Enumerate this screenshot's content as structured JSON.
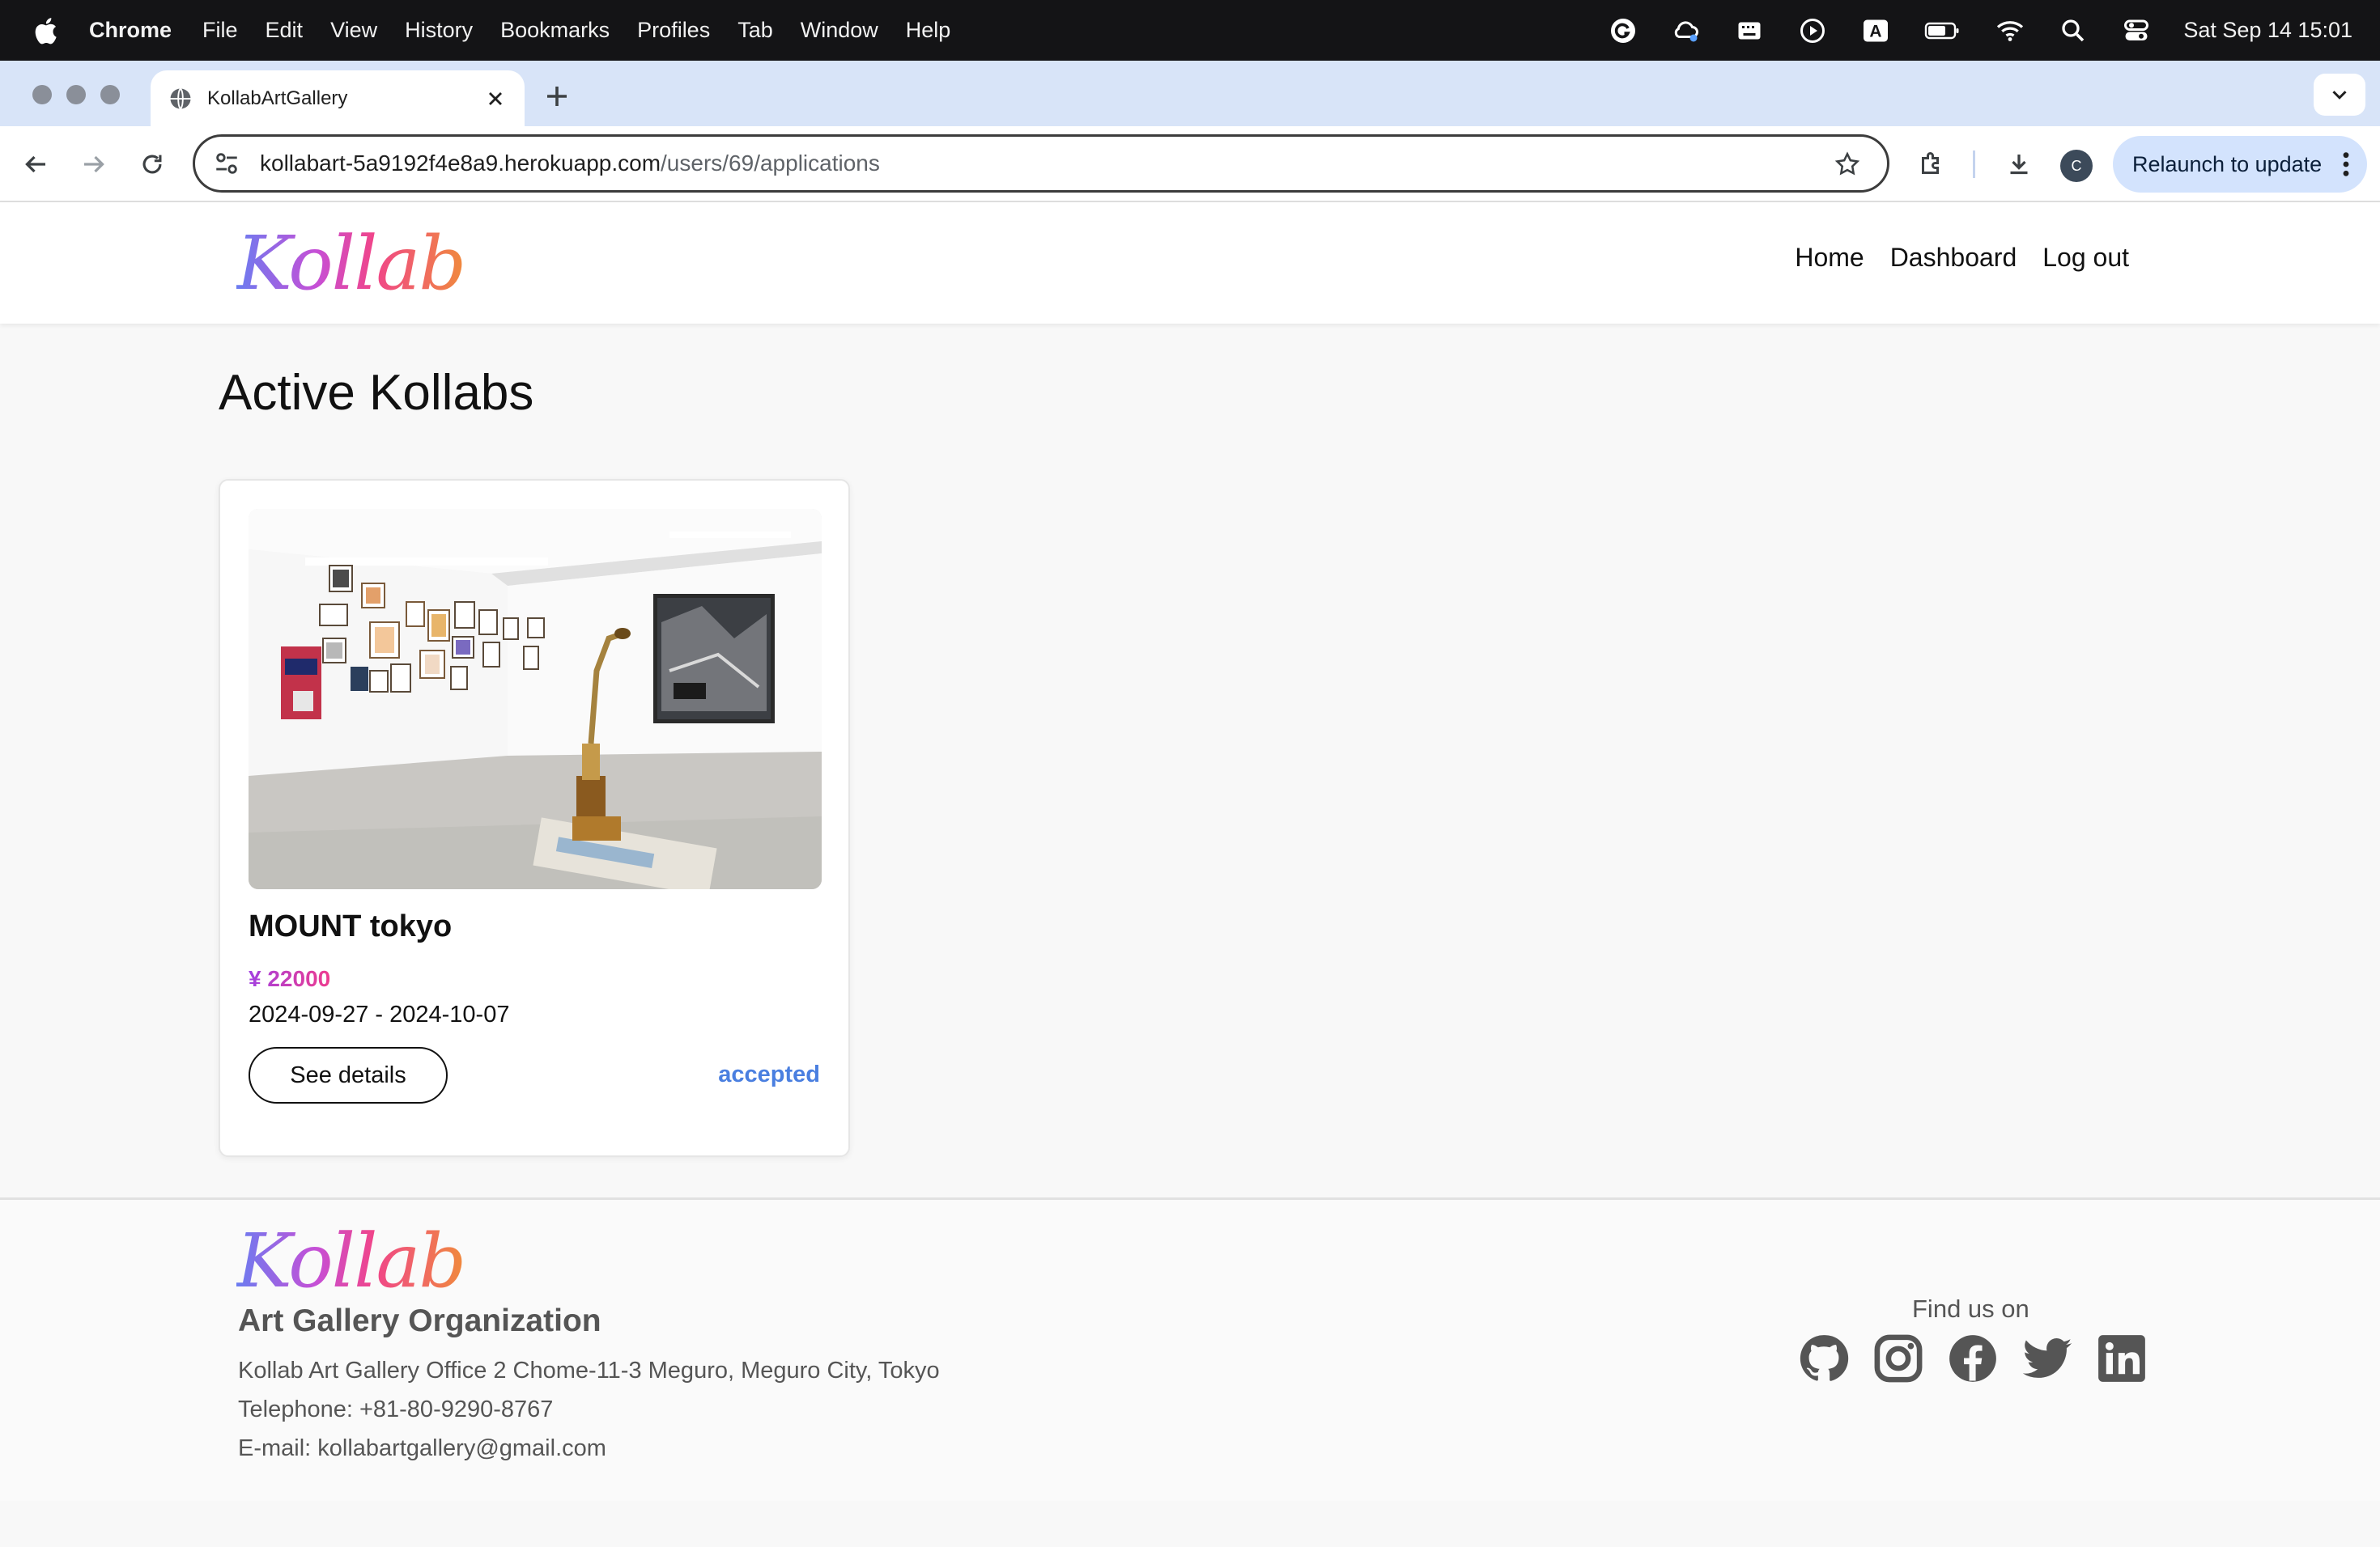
{
  "menubar": {
    "app_name": "Chrome",
    "items": [
      "File",
      "Edit",
      "View",
      "History",
      "Bookmarks",
      "Profiles",
      "Tab",
      "Window",
      "Help"
    ],
    "input_indicator": "A",
    "clock": "Sat Sep 14  15:01"
  },
  "browser": {
    "tab_title": "KollabArtGallery",
    "url_host": "kollabart-5a9192f4e8a9.herokuapp.com",
    "url_path": "/users/69/applications",
    "profile_initial": "C",
    "relaunch_label": "Relaunch to update"
  },
  "site": {
    "logo_text": "Kollab",
    "nav": {
      "home": "Home",
      "dashboard": "Dashboard",
      "logout": "Log out"
    }
  },
  "main": {
    "title": "Active Kollabs",
    "cards": [
      {
        "name": "MOUNT tokyo",
        "price": "¥ 22000",
        "dates": "2024-09-27 - 2024-10-07",
        "details_label": "See details",
        "status": "accepted"
      }
    ]
  },
  "footer": {
    "logo_text": "Kollab",
    "org": "Art Gallery Organization",
    "address": "Kollab Art Gallery Office 2 Chome-11-3 Meguro, Meguro City, Tokyo",
    "telephone": "Telephone: +81-80-9290-8767",
    "email": "E-mail: kollabartgallery@gmail.com",
    "find_us": "Find us on",
    "socials": [
      "github-icon",
      "instagram-icon",
      "facebook-icon",
      "twitter-icon",
      "linkedin-icon"
    ]
  },
  "colors": {
    "accent_status": "#4a7fe0",
    "price_gradient_start": "#a340e0",
    "price_gradient_end": "#ee3b8e",
    "chrome_frame": "#d8e4f8"
  }
}
